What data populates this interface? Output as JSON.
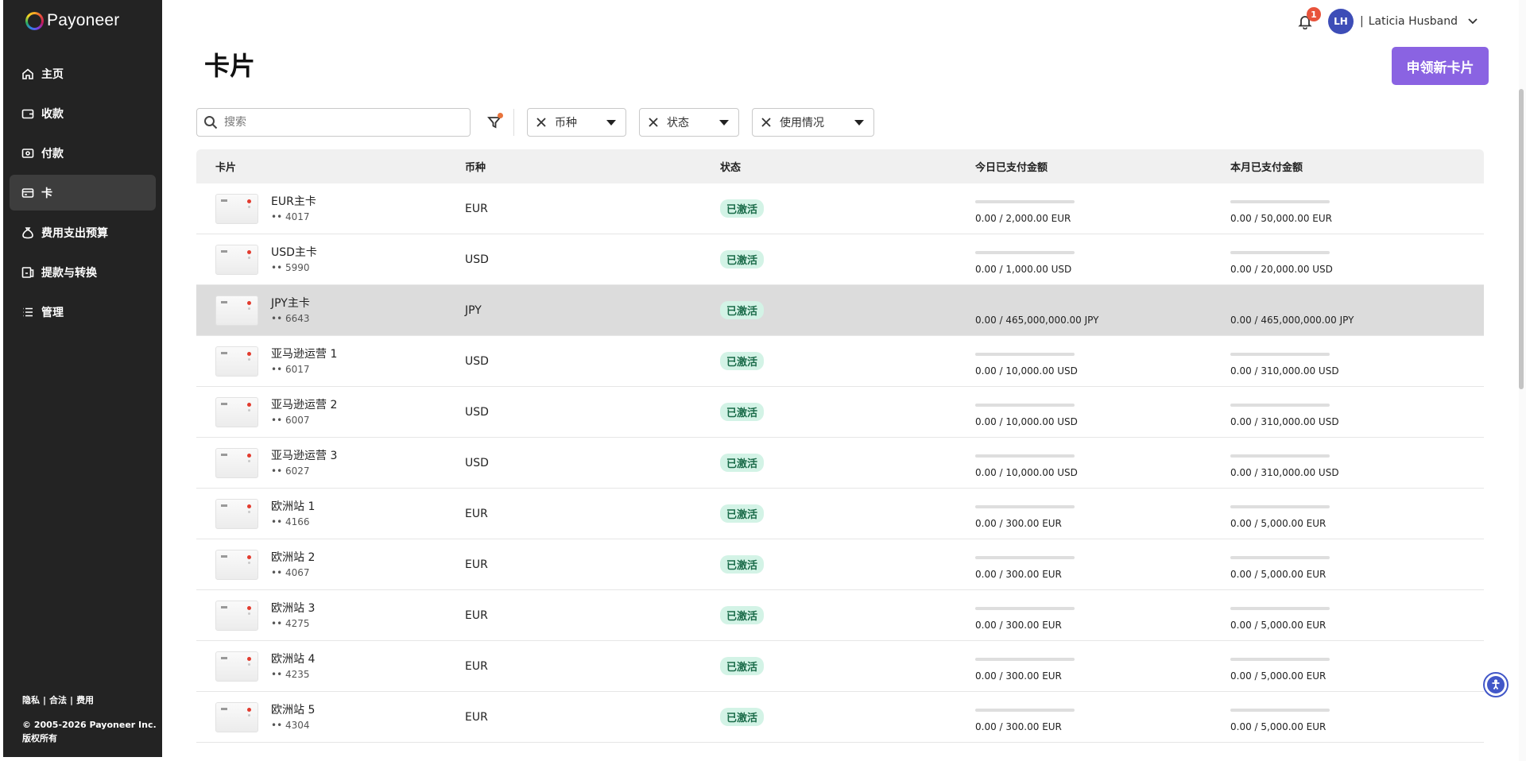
{
  "brand": {
    "name": "Payoneer"
  },
  "sidebar": {
    "items": [
      {
        "label": "主页",
        "icon": "home-icon",
        "active": false
      },
      {
        "label": "收款",
        "icon": "wallet-icon",
        "active": false
      },
      {
        "label": "付款",
        "icon": "payment-icon",
        "active": false
      },
      {
        "label": "卡",
        "icon": "card-icon",
        "active": true
      },
      {
        "label": "费用支出预算",
        "icon": "money-bag-icon",
        "active": false
      },
      {
        "label": "提款与转换",
        "icon": "withdraw-icon",
        "active": false
      },
      {
        "label": "管理",
        "icon": "list-icon",
        "active": false
      }
    ],
    "footer": {
      "links": [
        "隐私",
        "合法",
        "费用"
      ],
      "copyright": "© 2005-2026 Payoneer Inc.",
      "rights": "版权所有"
    }
  },
  "header": {
    "notification_count": "1",
    "user_initials": "LH",
    "user_name": "Laticia Husband"
  },
  "page": {
    "title": "卡片",
    "new_card_button": "申领新卡片"
  },
  "filters": {
    "search_placeholder": "搜索",
    "chips": [
      "币种",
      "状态",
      "使用情况"
    ]
  },
  "table": {
    "headers": [
      "卡片",
      "币种",
      "状态",
      "今日已支付金额",
      "本月已支付金额"
    ],
    "rows": [
      {
        "name": "EUR主卡",
        "number": "•• 4017",
        "currency": "EUR",
        "status": "已激活",
        "daily": "0.00 / 2,000.00 EUR",
        "monthly": "0.00 / 50,000.00 EUR",
        "daily_used": 0,
        "monthly_used": 0,
        "highlighted": false
      },
      {
        "name": "USD主卡",
        "number": "•• 5990",
        "currency": "USD",
        "status": "已激活",
        "daily": "0.00 / 1,000.00 USD",
        "monthly": "0.00 / 20,000.00 USD",
        "daily_used": 0,
        "monthly_used": 0,
        "highlighted": false
      },
      {
        "name": "JPY主卡",
        "number": "•• 6643",
        "currency": "JPY",
        "status": "已激活",
        "daily": "0.00 / 465,000,000.00 JPY",
        "monthly": "0.00 / 465,000,000.00 JPY",
        "daily_used": 0,
        "monthly_used": 0,
        "highlighted": true
      },
      {
        "name": "亚马逊运营 1",
        "number": "•• 6017",
        "currency": "USD",
        "status": "已激活",
        "daily": "0.00 / 10,000.00 USD",
        "monthly": "0.00 / 310,000.00 USD",
        "daily_used": 0,
        "monthly_used": 0,
        "highlighted": false
      },
      {
        "name": "亚马逊运营 2",
        "number": "•• 6007",
        "currency": "USD",
        "status": "已激活",
        "daily": "0.00 / 10,000.00 USD",
        "monthly": "0.00 / 310,000.00 USD",
        "daily_used": 0,
        "monthly_used": 0,
        "highlighted": false
      },
      {
        "name": "亚马逊运营 3",
        "number": "•• 6027",
        "currency": "USD",
        "status": "已激活",
        "daily": "0.00 / 10,000.00 USD",
        "monthly": "0.00 / 310,000.00 USD",
        "daily_used": 0,
        "monthly_used": 0,
        "highlighted": false
      },
      {
        "name": "欧洲站 1",
        "number": "•• 4166",
        "currency": "EUR",
        "status": "已激活",
        "daily": "0.00 / 300.00 EUR",
        "monthly": "0.00 / 5,000.00 EUR",
        "daily_used": 0,
        "monthly_used": 0,
        "highlighted": false
      },
      {
        "name": "欧洲站 2",
        "number": "•• 4067",
        "currency": "EUR",
        "status": "已激活",
        "daily": "0.00 / 300.00 EUR",
        "monthly": "0.00 / 5,000.00 EUR",
        "daily_used": 0,
        "monthly_used": 0,
        "highlighted": false
      },
      {
        "name": "欧洲站 3",
        "number": "•• 4275",
        "currency": "EUR",
        "status": "已激活",
        "daily": "0.00 / 300.00 EUR",
        "monthly": "0.00 / 5,000.00 EUR",
        "daily_used": 0,
        "monthly_used": 0,
        "highlighted": false
      },
      {
        "name": "欧洲站 4",
        "number": "•• 4235",
        "currency": "EUR",
        "status": "已激活",
        "daily": "0.00 / 300.00 EUR",
        "monthly": "0.00 / 5,000.00 EUR",
        "daily_used": 0,
        "monthly_used": 0,
        "highlighted": false
      },
      {
        "name": "欧洲站 5",
        "number": "•• 4304",
        "currency": "EUR",
        "status": "已激活",
        "daily": "0.00 / 300.00 EUR",
        "monthly": "0.00 / 5,000.00 EUR",
        "daily_used": 0,
        "monthly_used": 0,
        "highlighted": false
      }
    ]
  },
  "colors": {
    "sidebar_bg": "#232323",
    "accent": "#8a63e2",
    "status_badge_bg": "#d3f3e6",
    "notification_badge": "#e8533b",
    "avatar_bg": "#3d4db7"
  }
}
